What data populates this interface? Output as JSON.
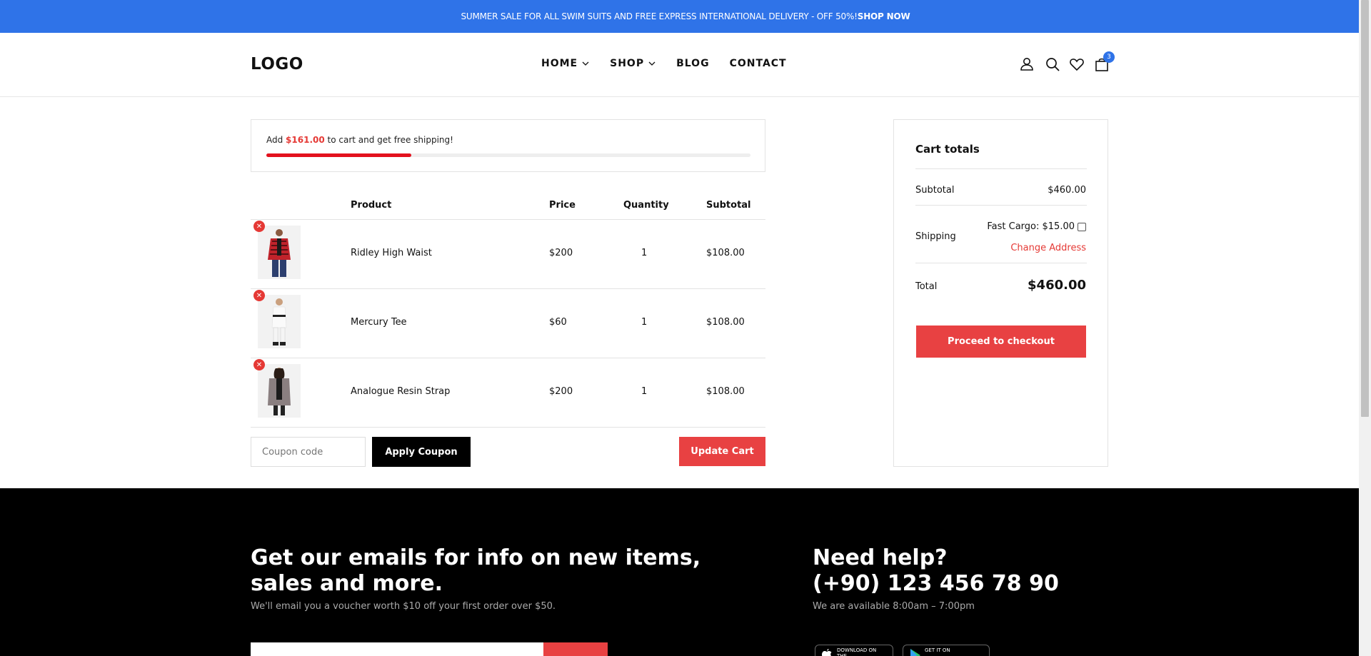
{
  "announcement": {
    "text": "SUMMER SALE FOR ALL SWIM SUITS AND FREE EXPRESS INTERNATIONAL DELIVERY - OFF 50%!",
    "link": "SHOP NOW"
  },
  "header": {
    "logo": "LOGO",
    "nav": [
      "HOME",
      "SHOP",
      "BLOG",
      "CONTACT"
    ],
    "cart_count": "3"
  },
  "shipping": {
    "prefix": "Add ",
    "amount": "$161.00",
    "suffix": " to cart and get free shipping!",
    "progress": 0.3
  },
  "table": {
    "headers": {
      "product": "Product",
      "price": "Price",
      "quantity": "Quantity",
      "subtotal": "Subtotal"
    },
    "rows": [
      {
        "name": "Ridley High Waist",
        "price": "$200",
        "qty": "1",
        "subtotal": "$108.00"
      },
      {
        "name": "Mercury Tee",
        "price": "$60",
        "qty": "1",
        "subtotal": "$108.00"
      },
      {
        "name": "Analogue Resin Strap",
        "price": "$200",
        "qty": "1",
        "subtotal": "$108.00"
      }
    ]
  },
  "actions": {
    "coupon_placeholder": "Coupon code",
    "apply_label": "Apply Coupon",
    "update_label": "Update Cart"
  },
  "totals": {
    "title": "Cart totals",
    "subtotal_label": "Subtotal",
    "subtotal_value": "$460.00",
    "shipping_label": "Shipping",
    "shipping_option": "Fast Cargo: $15.00",
    "change_address": "Change Address",
    "total_label": "Total",
    "total_value": "$460.00",
    "checkout_label": "Proceed to checkout"
  },
  "footer": {
    "newsletter_title_1": "Get our emails for info on new items,",
    "newsletter_title_2": "sales and more.",
    "newsletter_sub": "We'll email you a voucher worth $10 off your first order over $50.",
    "help_title": "Need help?",
    "help_phone": "(+90) 123 456 78 90",
    "help_hours": "We are available 8:00am – 7:00pm",
    "app_store": "DOWNLOAD ON THE",
    "play_store": "GET IT ON"
  },
  "colors": {
    "accent_blue": "#2f73e8",
    "accent_red": "#e84142",
    "footer_bg": "#000000"
  }
}
